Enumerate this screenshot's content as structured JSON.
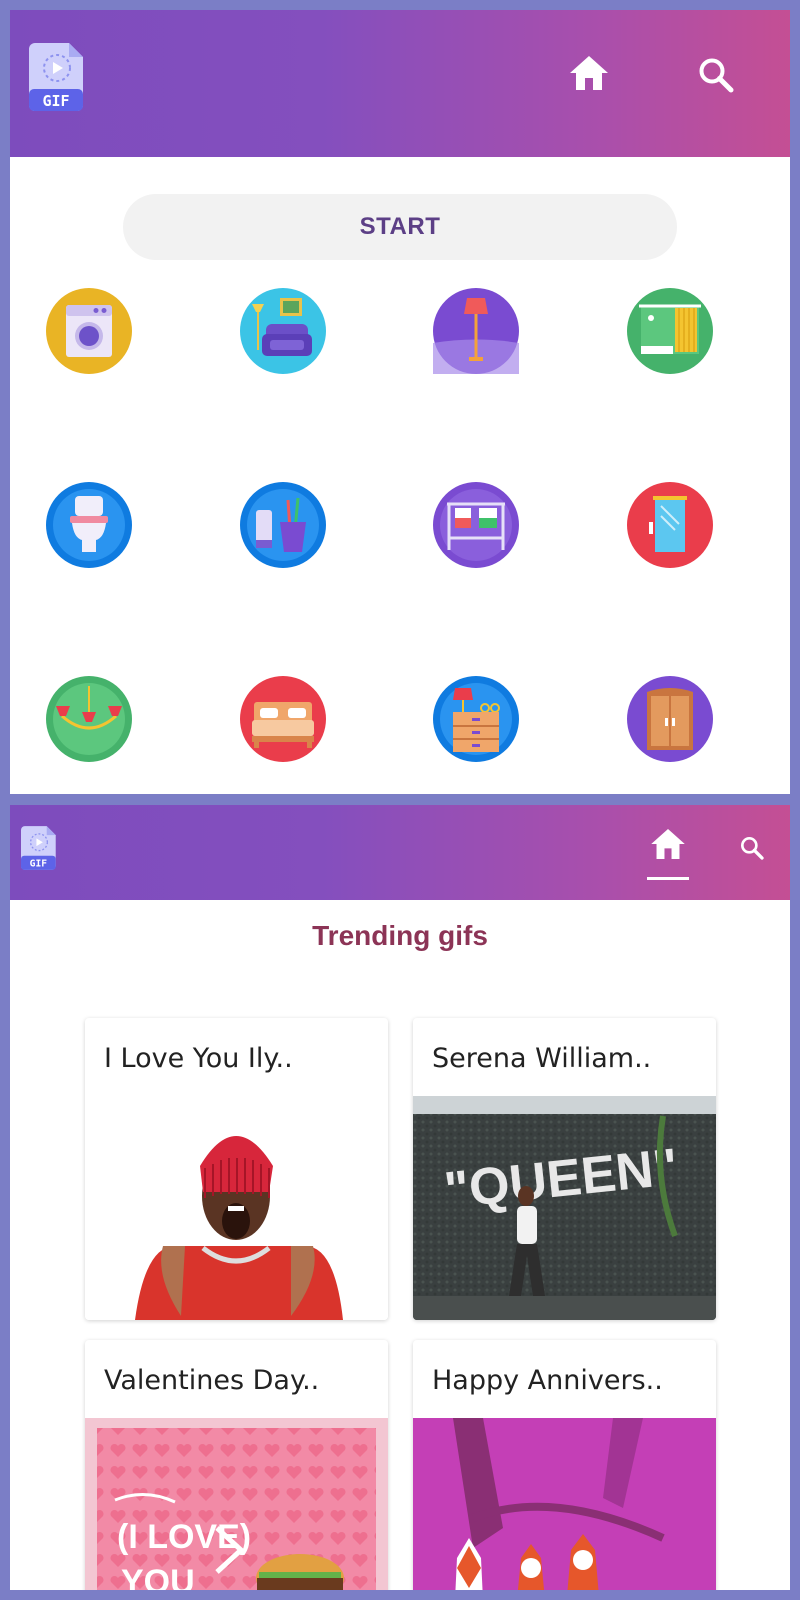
{
  "top_screen": {
    "logo": {
      "icon": "gif-file-icon",
      "text": "GIF"
    },
    "actions": [
      {
        "icon": "home-icon"
      },
      {
        "icon": "search-icon"
      }
    ],
    "start_label": "START",
    "categories": [
      {
        "icon": "washing-machine-icon",
        "color": "#e9b425"
      },
      {
        "icon": "armchair-lamp-icon",
        "color": "#3bc4e6"
      },
      {
        "icon": "floor-lamp-icon",
        "color": "#7a4bd1"
      },
      {
        "icon": "shower-curtain-icon",
        "color": "#45b26b"
      },
      {
        "icon": "toilet-icon",
        "color": "#0f7be0"
      },
      {
        "icon": "toothbrush-cup-icon",
        "color": "#0f7be0"
      },
      {
        "icon": "clothes-rack-icon",
        "color": "#7a4bd1"
      },
      {
        "icon": "mirror-cabinet-icon",
        "color": "#ea3d4b"
      },
      {
        "icon": "chandelier-icon",
        "color": "#45b26b"
      },
      {
        "icon": "bed-icon",
        "color": "#ea3d4b"
      },
      {
        "icon": "nightstand-icon",
        "color": "#0f7be0"
      },
      {
        "icon": "wardrobe-icon",
        "color": "#7a4bd1"
      }
    ]
  },
  "bottom_screen": {
    "logo": {
      "icon": "gif-file-icon",
      "text": "GIF"
    },
    "tabs": [
      {
        "icon": "home-icon",
        "active": true
      },
      {
        "icon": "search-icon",
        "active": false
      }
    ],
    "section_title": "Trending gifs",
    "cards": [
      {
        "title": "I Love You Ily..",
        "image": "man-shouting-red-shirt"
      },
      {
        "title": "Serena William..",
        "image": "queen-wall-woman"
      },
      {
        "title": "Valentines Day..",
        "image": "i-love-you-burger"
      },
      {
        "title": "Happy Annivers..",
        "image": "forest-foxes"
      }
    ]
  },
  "colors": {
    "appbar_start": "#7d4cbd",
    "appbar_end": "#c44f94",
    "start_text": "#5c3f86",
    "section_title": "#8c3456",
    "frame": "#7b7ec6"
  }
}
